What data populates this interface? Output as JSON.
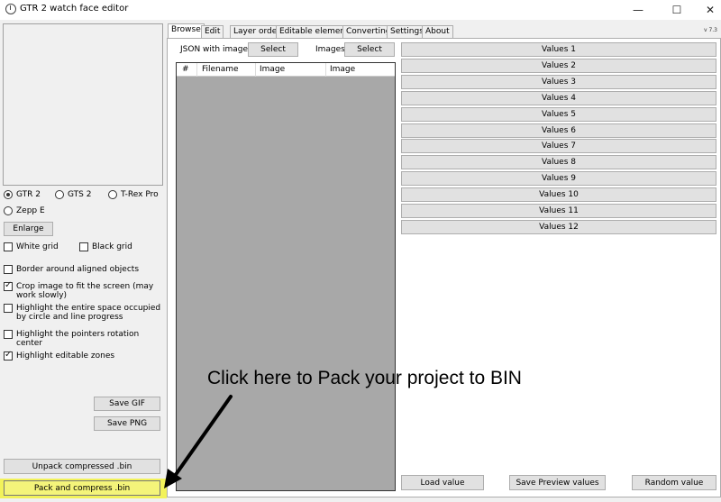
{
  "window": {
    "title": "GTR 2 watch face editor",
    "minimize": "—",
    "maximize": "☐",
    "close": "✕"
  },
  "left": {
    "radios": [
      {
        "label": "GTR 2",
        "checked": true
      },
      {
        "label": "GTS 2",
        "checked": false
      },
      {
        "label": "T-Rex Pro",
        "checked": false
      },
      {
        "label": "Zepp E",
        "checked": false
      }
    ],
    "enlarge_label": "Enlarge",
    "checks": [
      {
        "label": "White grid",
        "checked": false
      },
      {
        "label": "Black grid",
        "checked": false
      },
      {
        "label": "Border around aligned objects",
        "checked": false
      },
      {
        "label": "Crop image to fit the screen (may work slowly)",
        "checked": true
      },
      {
        "label": "Highlight the entire space occupied by circle and line progress",
        "checked": false
      },
      {
        "label": "Highlight the pointers rotation center",
        "checked": false
      },
      {
        "label": "Highlight editable zones",
        "checked": true
      }
    ],
    "save_gif_label": "Save GIF",
    "save_png_label": "Save PNG",
    "unpack_label": "Unpack compressed .bin",
    "pack_label": "Pack and compress .bin"
  },
  "tabs": [
    "Browse",
    "Edit",
    "Layer order",
    "Editable elements",
    "Converting",
    "Settings",
    "About"
  ],
  "version": "v 7.3",
  "browse": {
    "json_label": "JSON with images:",
    "json_select": "Select",
    "images_label": "Images:",
    "images_select": "Select",
    "columns": [
      "#",
      "Filename",
      "Image",
      "Image"
    ],
    "values": [
      "Values 1",
      "Values 2",
      "Values 3",
      "Values 4",
      "Values 5",
      "Values 6",
      "Values 7",
      "Values 8",
      "Values 9",
      "Values 10",
      "Values 11",
      "Values 12"
    ],
    "load_value": "Load value",
    "save_preview_values": "Save Preview values",
    "random_value": "Random value"
  },
  "annotation": {
    "text": "Click here to Pack your project to BIN"
  },
  "colors": {
    "highlight": "#f2f25a",
    "listview_bg": "#a8a8a8"
  }
}
